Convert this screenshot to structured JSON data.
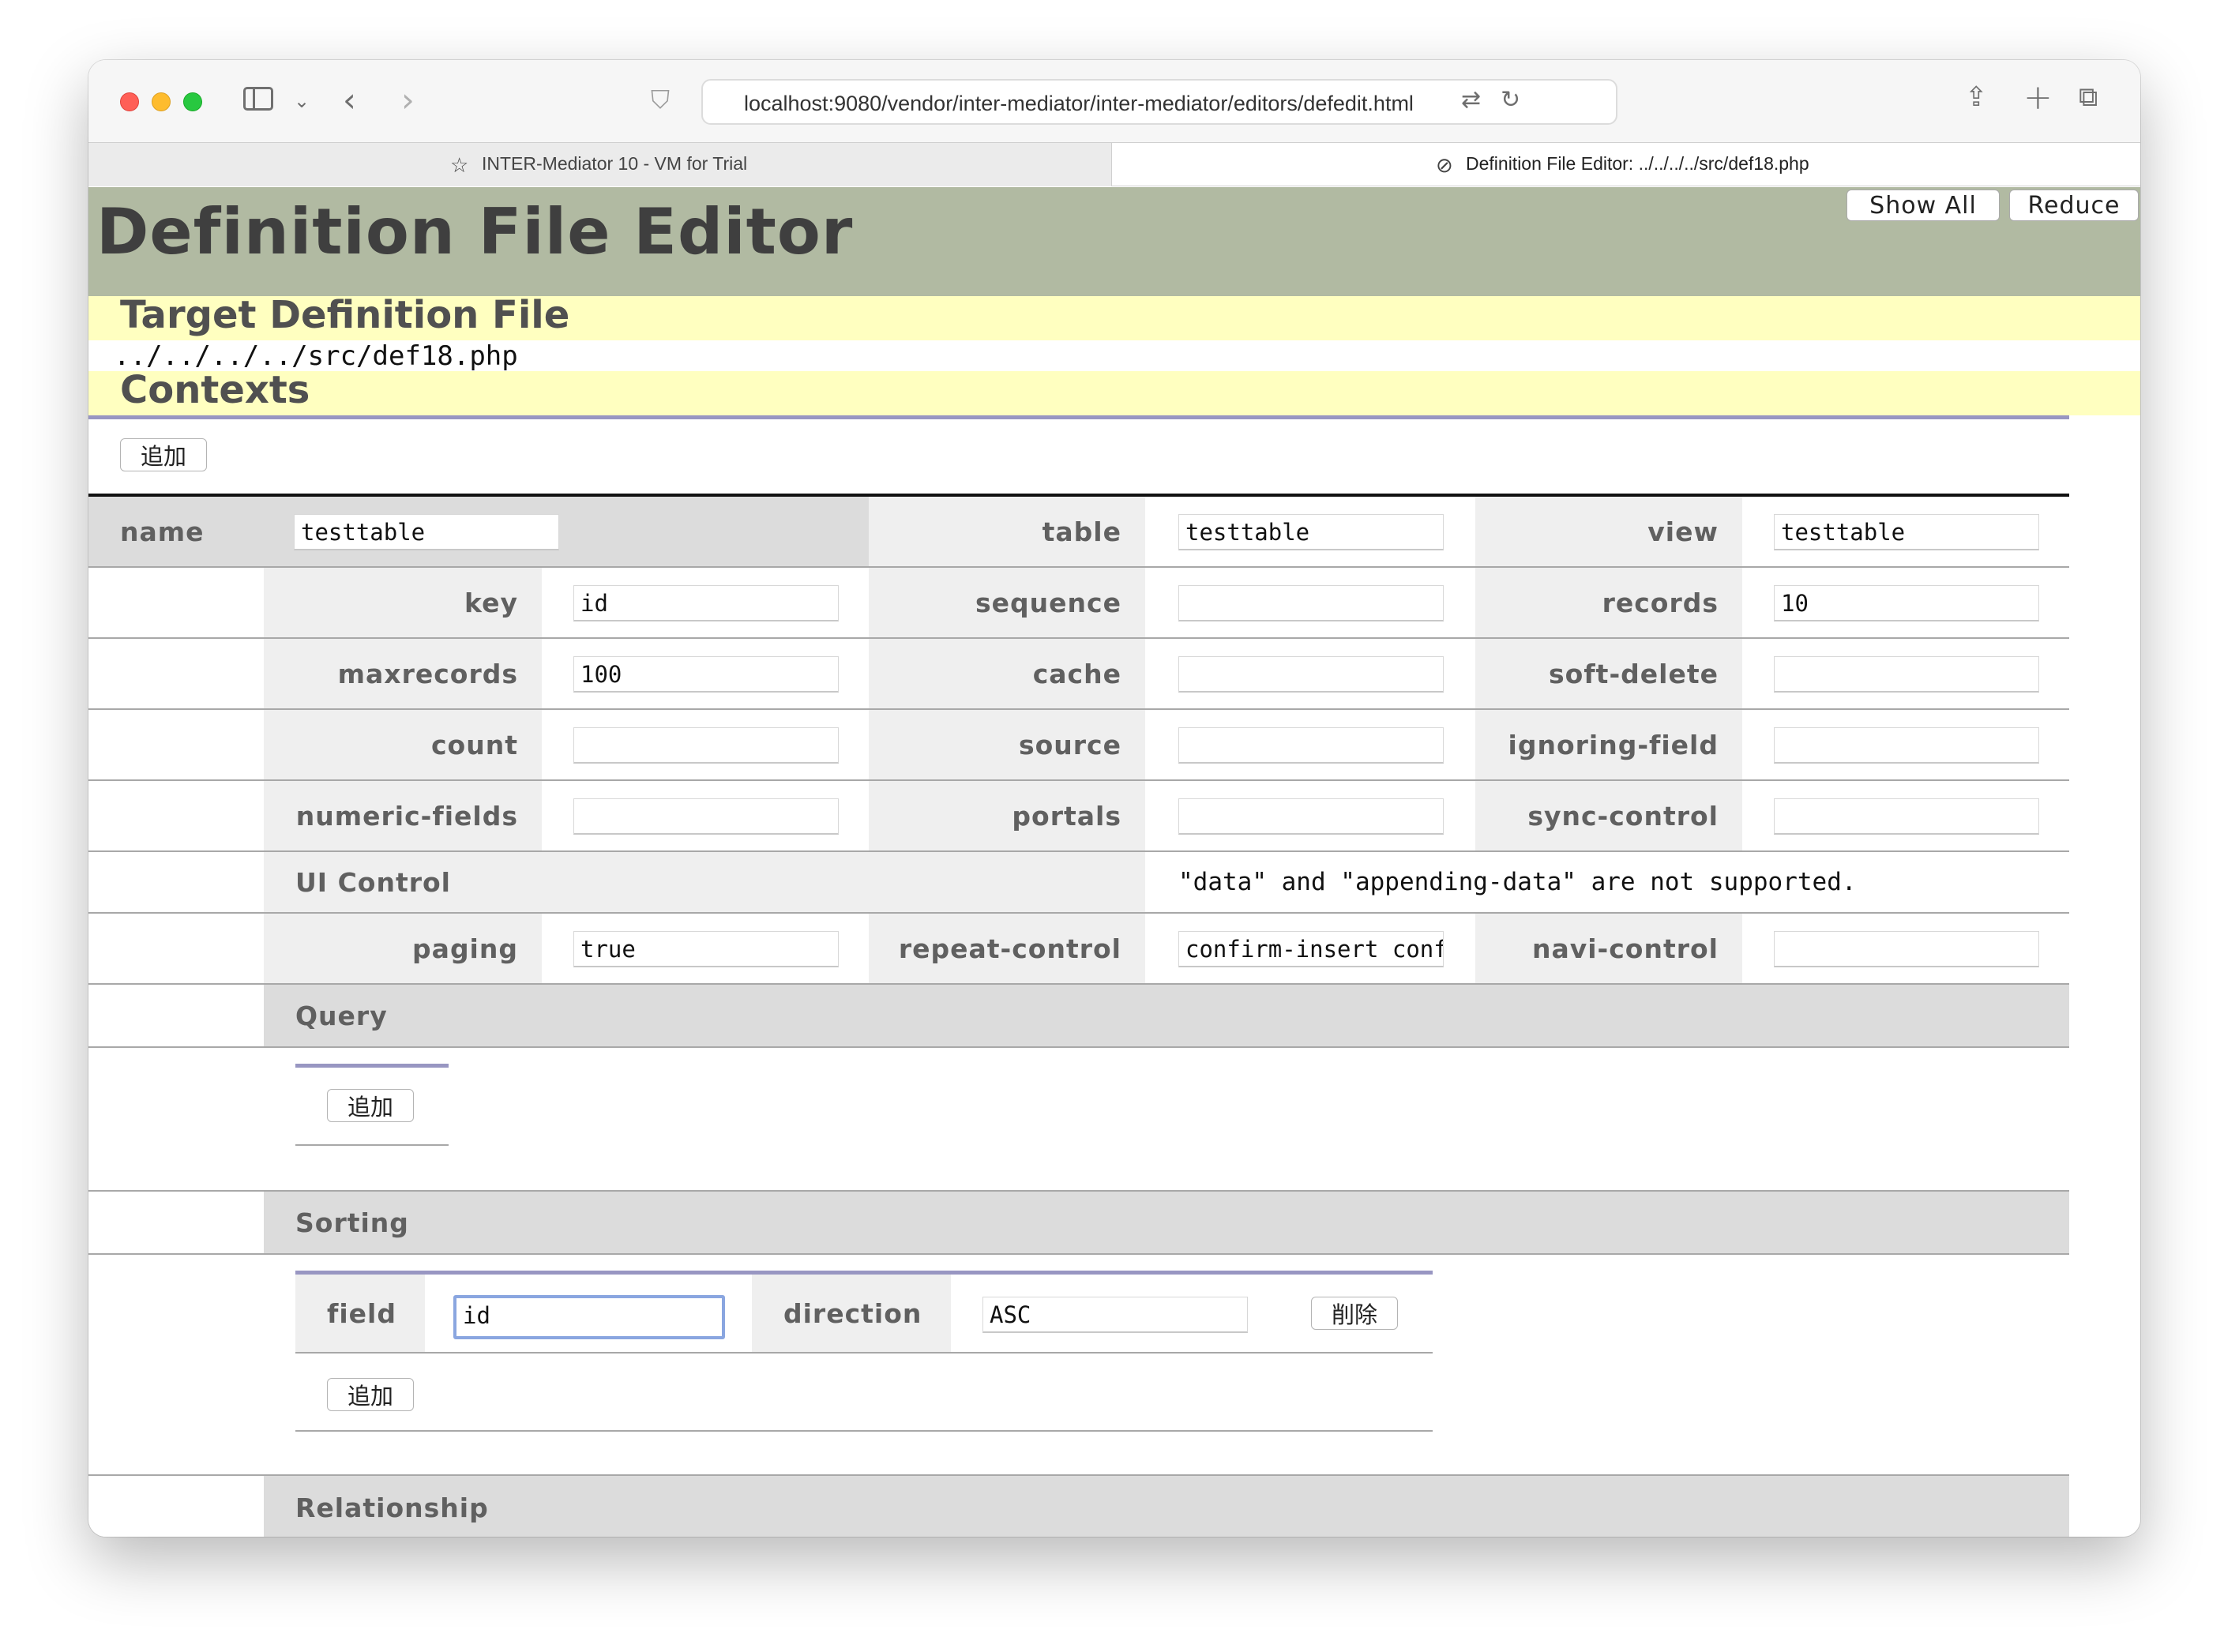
{
  "browser": {
    "url": "localhost:9080/vendor/inter-mediator/inter-mediator/editors/defedit.html",
    "tabs": [
      {
        "label": "INTER-Mediator 10 - VM for Trial"
      },
      {
        "label": "Definition File Editor: ../../../../src/def18.php"
      }
    ]
  },
  "page": {
    "title": "Definition File Editor",
    "show_all_label": "Show All",
    "reduce_label": "Reduce",
    "target_heading": "Target Definition File",
    "target_path": "../../../../src/def18.php",
    "contexts_heading": "Contexts",
    "add_label": "追加",
    "delete_label": "削除"
  },
  "context": {
    "name": {
      "label": "name",
      "value": "testtable"
    },
    "table": {
      "label": "table",
      "value": "testtable"
    },
    "view": {
      "label": "view",
      "value": "testtable"
    },
    "key": {
      "label": "key",
      "value": "id"
    },
    "sequence": {
      "label": "sequence",
      "value": ""
    },
    "records": {
      "label": "records",
      "value": "10"
    },
    "maxrecords": {
      "label": "maxrecords",
      "value": "100"
    },
    "cache": {
      "label": "cache",
      "value": ""
    },
    "soft_delete": {
      "label": "soft-delete",
      "value": ""
    },
    "count": {
      "label": "count",
      "value": ""
    },
    "source": {
      "label": "source",
      "value": ""
    },
    "ignoring_field": {
      "label": "ignoring-field",
      "value": ""
    },
    "numeric_fields": {
      "label": "numeric-fields",
      "value": ""
    },
    "portals": {
      "label": "portals",
      "value": ""
    },
    "sync_control": {
      "label": "sync-control",
      "value": ""
    },
    "ui_control": {
      "label": "UI Control",
      "note": "\"data\" and \"appending-data\" are not supported."
    },
    "paging": {
      "label": "paging",
      "value": "true"
    },
    "repeat_control": {
      "label": "repeat-control",
      "value": "confirm-insert confirm-delete"
    },
    "navi_control": {
      "label": "navi-control",
      "value": ""
    },
    "query": {
      "label": "Query"
    },
    "sorting": {
      "label": "Sorting",
      "field_label": "field",
      "field_value": "id",
      "direction_label": "direction",
      "direction_value": "ASC"
    },
    "relationship": {
      "label": "Relationship"
    }
  }
}
